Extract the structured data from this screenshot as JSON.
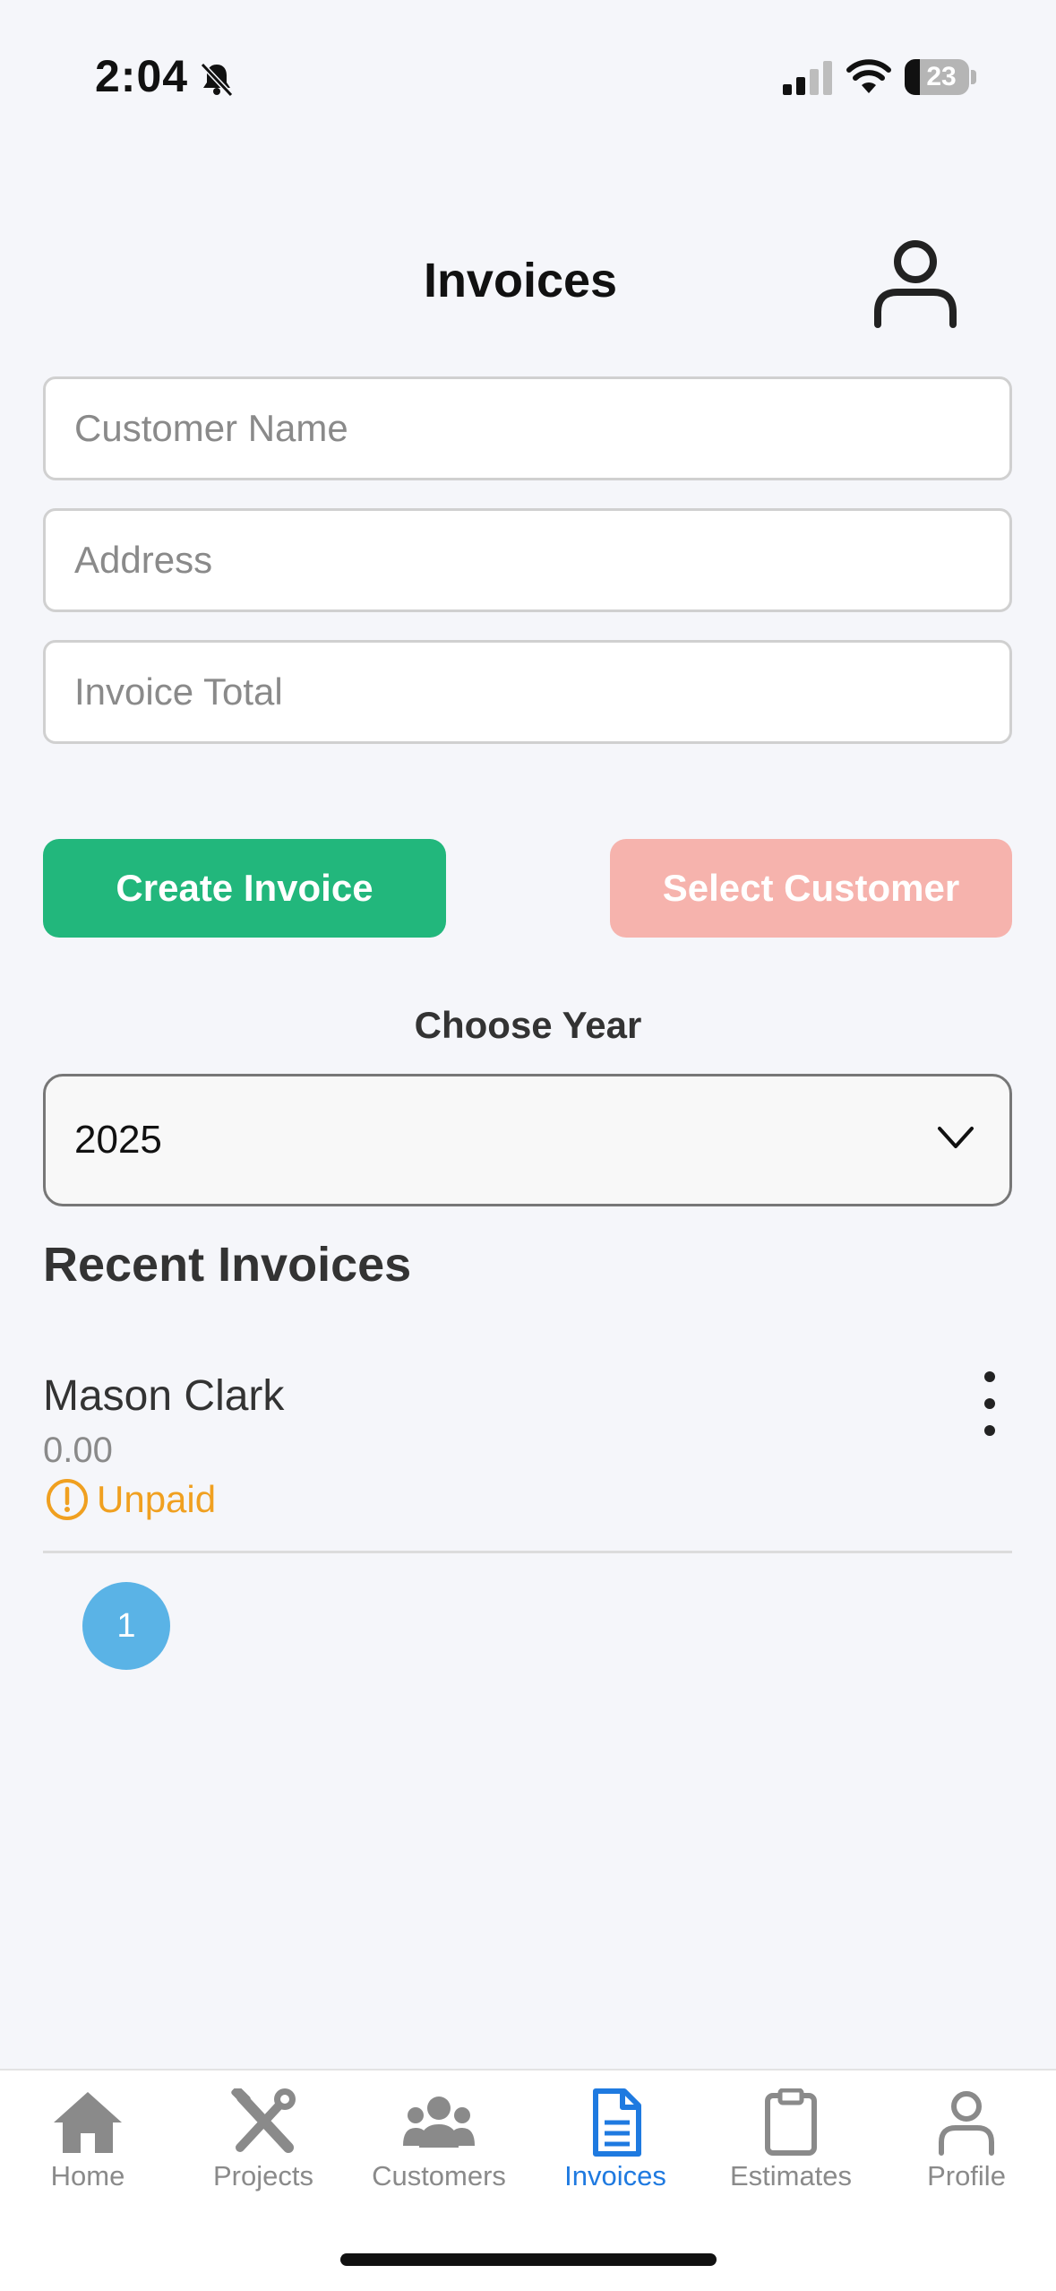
{
  "status_bar": {
    "time": "2:04",
    "battery": "23",
    "battery_level": 0.23
  },
  "header": {
    "title": "Invoices",
    "user_icon": "user-icon"
  },
  "form": {
    "customer_name_placeholder": "Customer Name",
    "address_placeholder": "Address",
    "invoice_total_placeholder": "Invoice Total",
    "customer_name_value": "",
    "address_value": "",
    "invoice_total_value": ""
  },
  "buttons": {
    "create_invoice": "Create Invoice",
    "select_customer": "Select Customer",
    "create_color": "#22b77c",
    "select_color": "#f6b3ad"
  },
  "year_picker": {
    "label": "Choose Year",
    "selected": "2025"
  },
  "recent": {
    "title": "Recent Invoices",
    "items": [
      {
        "name": "Mason Clark",
        "amount": "0.00",
        "status": "Unpaid",
        "status_color": "#f0a020"
      }
    ]
  },
  "pagination": {
    "current_page": "1"
  },
  "tab_bar": {
    "active_color": "#1f7ae0",
    "tabs": [
      {
        "label": "Home",
        "icon": "home-icon"
      },
      {
        "label": "Projects",
        "icon": "tools-icon"
      },
      {
        "label": "Customers",
        "icon": "users-icon"
      },
      {
        "label": "Invoices",
        "icon": "document-icon",
        "active": true
      },
      {
        "label": "Estimates",
        "icon": "clipboard-icon"
      },
      {
        "label": "Profile",
        "icon": "user-icon"
      }
    ]
  }
}
